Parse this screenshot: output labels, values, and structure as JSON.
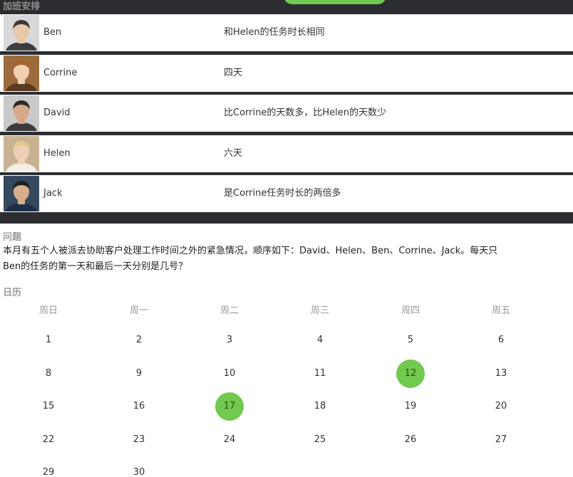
{
  "overtime": {
    "title": "加班安排",
    "rows": [
      {
        "name": "Ben",
        "desc": "和Helen的任务时长相同",
        "avatar_bg": "#d8d8d8",
        "hair": "#3a3a3a",
        "skin": "#e6c7a8",
        "shirt": "#3d3d3d"
      },
      {
        "name": "Corrine",
        "desc": "四天",
        "avatar_bg": "#9b6b3d",
        "hair": "#a8622a",
        "skin": "#f1cfb2",
        "shirt": "#5a3a22"
      },
      {
        "name": "David",
        "desc": "比Corrine的天数多，比Helen的天数少",
        "avatar_bg": "#c9c9c9",
        "hair": "#2a2a2a",
        "skin": "#d8a88a",
        "shirt": "#3b3b3b"
      },
      {
        "name": "Helen",
        "desc": "六天",
        "avatar_bg": "#c7b394",
        "hair": "#e3c98a",
        "skin": "#f0cfb8",
        "shirt": "#f2efe8"
      },
      {
        "name": "Jack",
        "desc": "是Corrine任务时长的两倍多",
        "avatar_bg": "#34495e",
        "hair": "#1f1f1f",
        "skin": "#d9ae8e",
        "shirt": "#1c2f47"
      }
    ]
  },
  "question": {
    "title": "问题",
    "text": "本月有五个人被派去协助客户处理工作时间之外的紧急情况，顺序如下：David、Helen、Ben、Corrine、Jack。每天只\nBen的任务的第一天和最后一天分别是几号？"
  },
  "calendar": {
    "title": "日历",
    "weekdays": [
      "周日",
      "周一",
      "周二",
      "周三",
      "周四",
      "周五"
    ],
    "weeks": [
      [
        "1",
        "2",
        "3",
        "4",
        "5",
        "6"
      ],
      [
        "8",
        "9",
        "10",
        "11",
        "12",
        "13"
      ],
      [
        "15",
        "16",
        "17",
        "18",
        "19",
        "20"
      ],
      [
        "22",
        "23",
        "24",
        "25",
        "26",
        "27"
      ],
      [
        "29",
        "30"
      ]
    ],
    "selected": [
      "12",
      "17"
    ],
    "accent": "#71c94f"
  }
}
